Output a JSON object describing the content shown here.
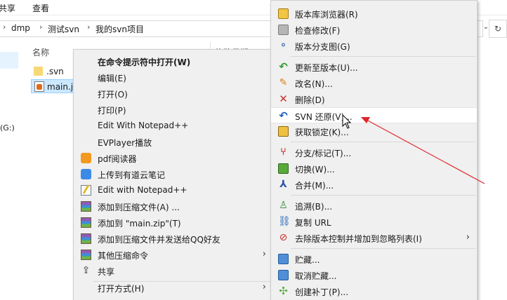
{
  "ribbon": {
    "share_label": "共享",
    "view_label": "查看"
  },
  "address": {
    "crumbs": [
      "dmp",
      "测试svn",
      "我的svn项目"
    ]
  },
  "nav": {
    "drive_label": "(G:)"
  },
  "file_list": {
    "col_name": "名称",
    "col_date": "修改日期",
    "files": [
      {
        "name": ".svn"
      },
      {
        "name": "main.js"
      }
    ]
  },
  "left_menu": {
    "items": [
      {
        "label": "在命令提示符中打开(W)"
      },
      {
        "label": "编辑(E)"
      },
      {
        "label": "打开(O)"
      },
      {
        "label": "打印(P)"
      },
      {
        "label": "Edit With Notepad++"
      },
      {
        "label": "EVPlayer播放"
      },
      {
        "label": "pdf阅读器"
      },
      {
        "label": "上传到有道云笔记"
      },
      {
        "label": "Edit with Notepad++"
      },
      {
        "label": "添加到压缩文件(A) ..."
      },
      {
        "label": "添加到 \"main.zip\"(T)"
      },
      {
        "label": "添加到压缩文件并发送给QQ好友"
      },
      {
        "label": "其他压缩命令"
      },
      {
        "label": "共享"
      },
      {
        "label": "打开方式(H)"
      }
    ]
  },
  "right_menu": {
    "items": [
      {
        "label": "版本库浏览器(R)"
      },
      {
        "label": "检查修改(F)"
      },
      {
        "label": "版本分支图(G)"
      },
      {
        "label": "更新至版本(U)..."
      },
      {
        "label": "改名(N)..."
      },
      {
        "label": "删除(D)"
      },
      {
        "label": "SVN 还原(V)..."
      },
      {
        "label": "获取锁定(K)..."
      },
      {
        "label": "分支/标记(T)..."
      },
      {
        "label": "切换(W)..."
      },
      {
        "label": "合并(M)..."
      },
      {
        "label": "追溯(B)..."
      },
      {
        "label": "复制 URL"
      },
      {
        "label": "去除版本控制并增加到忽略列表(I)"
      },
      {
        "label": "贮藏..."
      },
      {
        "label": "取消贮藏..."
      },
      {
        "label": "创建补丁(P)..."
      }
    ]
  },
  "colors": {
    "menu_bg": "#f0f0f0",
    "annotation": "#e0262b",
    "selection": "#cce8ff"
  }
}
